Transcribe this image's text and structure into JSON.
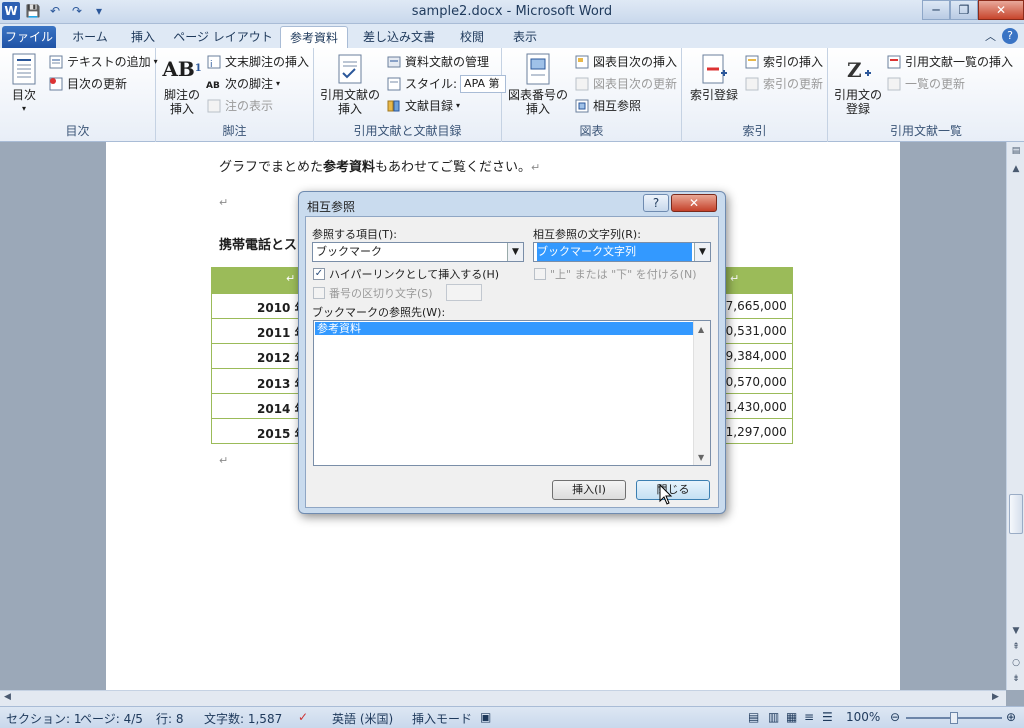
{
  "window": {
    "title": "sample2.docx - Microsoft Word",
    "minimize_glyph": "─",
    "maximize_glyph": "❐",
    "close_glyph": "✕"
  },
  "qat": {
    "logo": "W",
    "save": "💾",
    "undo": "↶",
    "redo": "↷",
    "custom": "▾"
  },
  "tabs": [
    "ファイル",
    "ホーム",
    "挿入",
    "ページ レイアウト",
    "参考資料",
    "差し込み文書",
    "校閲",
    "表示"
  ],
  "ribbon": {
    "toc_group": {
      "label": "目次",
      "big": "目次",
      "add_text": "テキストの追加",
      "update_toc": "目次の更新"
    },
    "footnote_group": {
      "label": "脚注",
      "big_line1": "脚注の",
      "big_line2": "挿入",
      "endnote": "文末脚注の挿入",
      "next": "次の脚注",
      "show": "注の表示"
    },
    "citation_group": {
      "label": "引用文献と文献目録",
      "big_line1": "引用文献の",
      "big_line2": "挿入",
      "manage": "資料文献の管理",
      "style_label": "スタイル:",
      "style_value": "APA 第",
      "bibliography": "文献目録"
    },
    "caption_group": {
      "label": "図表",
      "big_line1": "図表番号の",
      "big_line2": "挿入",
      "insert_table_of_figures": "図表目次の挿入",
      "update_table": "図表目次の更新",
      "cross_reference": "相互参照"
    },
    "index_group": {
      "label": "索引",
      "big": "索引登録",
      "insert_index": "索引の挿入",
      "update_index": "索引の更新"
    },
    "authorities_group": {
      "label": "引用文献一覧",
      "big_line1": "引用文の",
      "big_line2": "登録",
      "insert_table": "引用文献一覧の挿入",
      "update_table": "一覧の更新"
    }
  },
  "document": {
    "line1_prefix": "グラフでまとめた",
    "line1_bold": "参考資料",
    "line1_suffix": "もあわせてご覧ください。",
    "paragraph_mark": "↵",
    "heading": "携帯電話とス",
    "rows": [
      {
        "year": "2010 年",
        "value": "37,665,000"
      },
      {
        "year": "2011 年",
        "value": "40,531,000"
      },
      {
        "year": "2012 年",
        "value": "39,384,000"
      },
      {
        "year": "2013 年",
        "value": "40,570,000"
      },
      {
        "year": "2014 年",
        "value": "41,430,000"
      },
      {
        "year": "2015 年",
        "value": "41,297,000"
      }
    ]
  },
  "dialog": {
    "title": "相互参照",
    "help": "?",
    "close": "✕",
    "ref_type_label": "参照する項目(T):",
    "ref_type_value": "ブックマーク",
    "ref_text_label": "相互参照の文字列(R):",
    "ref_text_value": "ブックマーク文字列",
    "hyperlink_label": "ハイパーリンクとして挿入する(H)",
    "hyperlink_checked": true,
    "above_below_label": "\"上\" または \"下\" を付ける(N)",
    "separator_label": "番号の区切り文字(S)",
    "for_which_label": "ブックマークの参照先(W):",
    "list_items": [
      "参考資料"
    ],
    "insert_button": "挿入(I)",
    "close_button": "閉じる"
  },
  "statusbar": {
    "section": "セクション: 1",
    "page": "ページ: 4/5",
    "line": "行: 8",
    "words": "文字数: 1,587",
    "language": "英語 (米国)",
    "mode": "挿入モード",
    "zoom": "100%",
    "zoom_level_percent": 100
  },
  "colors": {
    "accent": "#2b579a",
    "table_header": "#9bbb59",
    "selection": "#3399ff"
  }
}
